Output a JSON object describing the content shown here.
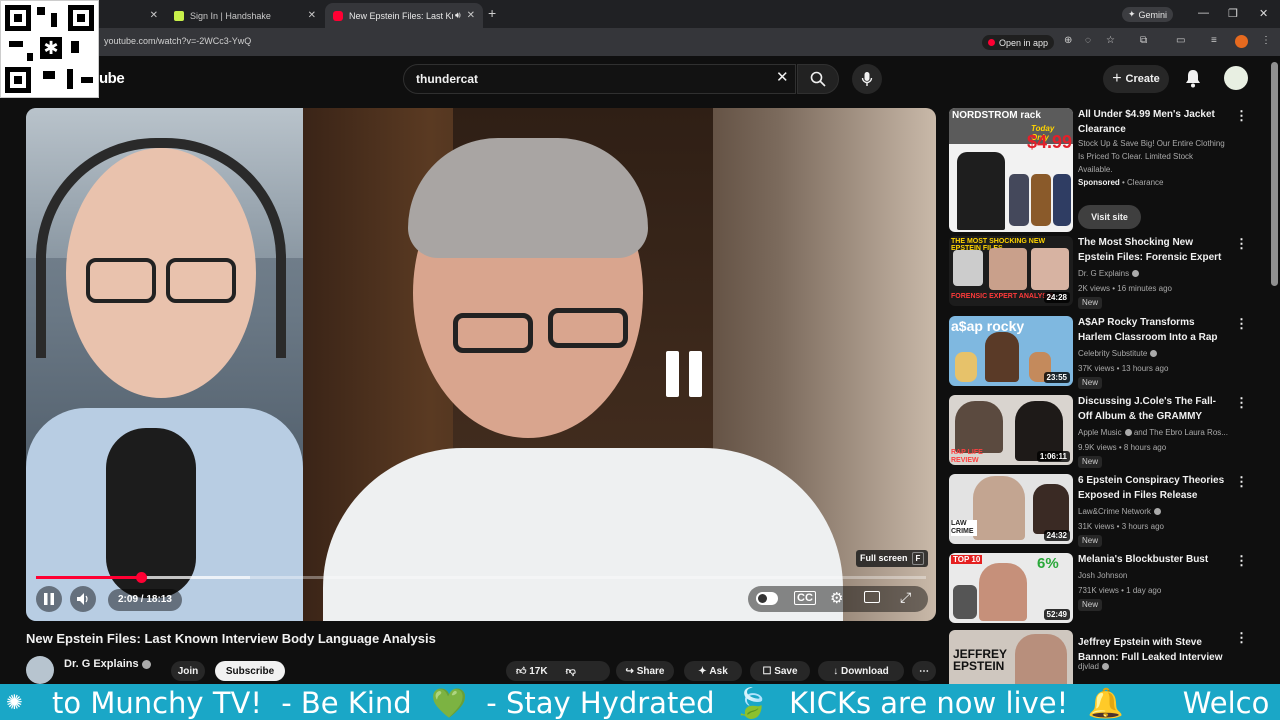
{
  "browser": {
    "tabs": [
      {
        "label": "",
        "close": "✕"
      },
      {
        "label": "Sign In | Handshake",
        "close": "✕"
      },
      {
        "label": "New Epstein Files: Last Kno",
        "close": "✕"
      }
    ],
    "new_tab": "+",
    "url": "youtube.com/watch?v=-2WCc3-YwQ",
    "open_in_app": "Open in app",
    "gemini": "Gemini",
    "minimize": "—",
    "restore": "❐",
    "close": "✕"
  },
  "youtube": {
    "logo_fragment": "ube",
    "search_value": "thundercat",
    "create_label": "Create"
  },
  "player": {
    "current_time": "2:09",
    "duration": "18:13",
    "time_display": "2:09 / 18:13",
    "progress_fraction": 0.118,
    "fullscreen_tooltip": "Full screen",
    "fullscreen_key": "F",
    "state": "paused-indicator"
  },
  "video": {
    "title": "New Epstein Files: Last Known Interview Body Language Analysis",
    "channel": "Dr. G Explains",
    "join_label": "Join",
    "subscribe_label": "Subscribe",
    "likes": "17K",
    "share_label": "Share",
    "ask_label": "Ask",
    "save_label": "Save",
    "download_label": "Download"
  },
  "sidebar": {
    "ad": {
      "title": "All Under $4.99 Men's Jacket Clearance",
      "description": "Stock Up & Save Big! Our Entire Clothing Is Priced To Clear. Limited Stock Available.",
      "sponsored": "Sponsored",
      "advertiser": "Clearance",
      "visit_label": "Visit site",
      "thumb_brand": "NORDSTROM rack",
      "thumb_promo": "Today Only",
      "thumb_price": "$4.99"
    },
    "items": [
      {
        "title": "The Most Shocking New Epstein Files: Forensic Expert ...",
        "channel": "Dr. G Explains",
        "meta": "2K views • 16 minutes ago",
        "badge": "New",
        "duration": "24:28",
        "thumb_text": "THE MOST SHOCKING NEW EPSTEIN FILES",
        "thumb_sub": "FORENSIC EXPERT ANALYSIS"
      },
      {
        "title": "A$AP Rocky Transforms Harlem Classroom Into a Rap Video ...",
        "channel": "Celebrity Substitute",
        "meta": "37K views • 13 hours ago",
        "badge": "New",
        "duration": "23:55",
        "thumb_text": "a$ap rocky"
      },
      {
        "title": "Discussing J.Cole's The Fall-Off Album & the GRAMMY Awards...",
        "channel": "Apple Music",
        "channel_extra": "and The Ebro Laura Ros...",
        "meta": "9.9K views • 8 hours ago",
        "badge": "New",
        "duration": "1:06:11",
        "thumb_text": "RAP LIFE REVIEW"
      },
      {
        "title": "6 Epstein Conspiracy Theories Exposed in Files Release",
        "channel": "Law&Crime Network",
        "meta": "31K views • 3 hours ago",
        "badge": "New",
        "duration": "24:32",
        "thumb_text": "LAW CRIME"
      },
      {
        "title": "Melania's Blockbuster Bust",
        "channel": "Josh Johnson",
        "meta": "731K views • 1 day ago",
        "badge": "New",
        "duration": "52:49",
        "thumb_text": "TOP 10",
        "thumb_pct": "6%"
      },
      {
        "title": "Jeffrey Epstein with Steve Bannon: Full Leaked Interview",
        "channel": "djvlad",
        "meta": "",
        "badge": "",
        "duration": "",
        "thumb_text": "JEFFREY EPSTEIN"
      }
    ]
  },
  "ticker": {
    "segments": [
      "to Munchy TV!",
      "- Be Kind",
      "💚",
      "- Stay Hydrated",
      "🍃",
      "KICKs are now live!",
      "🔔",
      "Welco"
    ]
  },
  "colors": {
    "accent_red": "#ff0033",
    "ticker_bg": "#1aa7c7",
    "page_bg": "#0f0f0f"
  }
}
